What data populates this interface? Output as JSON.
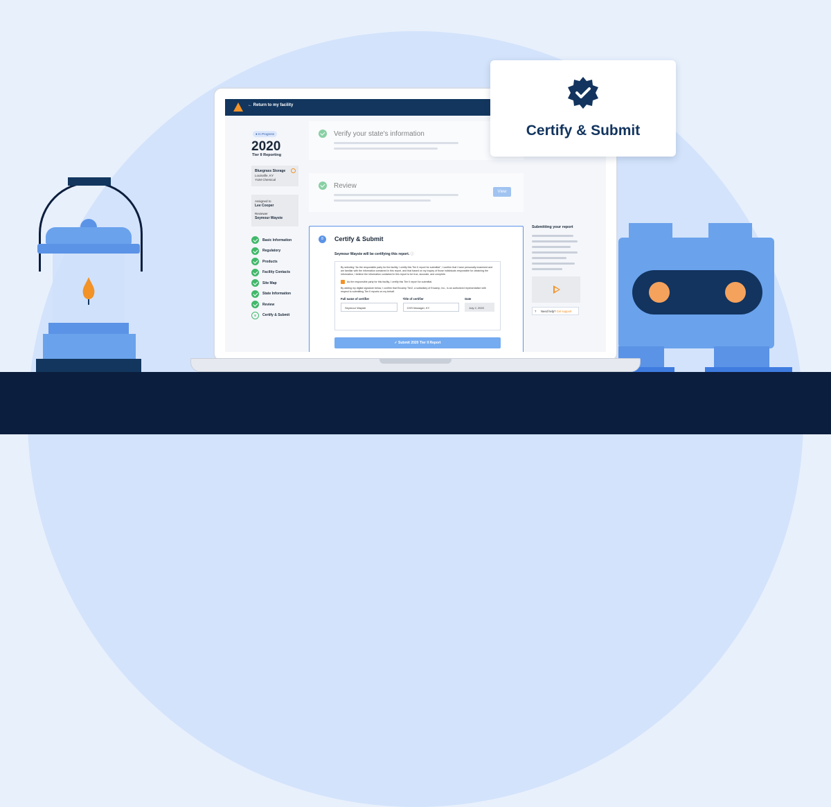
{
  "popup": {
    "title": "Certify & Submit",
    "badge_icon": "verified-check-badge"
  },
  "app": {
    "back_link": "Return to my facility",
    "status_badge": "In Progress",
    "year": "2020",
    "report_type": "Tier II Reporting",
    "facility": {
      "name": "Bluegrass Storage",
      "location": "Louisville, KY",
      "company": "YUM Chemical"
    },
    "assigned_label": "Assigned to",
    "assigned_name": "Lee Cooper",
    "reviewer_label": "Reviewer",
    "reviewer_name": "Seymour Wayste",
    "steps": [
      "Basic Information",
      "Regulatory",
      "Products",
      "Facility Contacts",
      "Site Map",
      "State Information",
      "Review",
      "Certify & Submit"
    ],
    "current_step_number": "8",
    "section1_title": "Verify your state's information",
    "section2_title": "Review",
    "view_button": "View",
    "section3_title": "Certify & Submit",
    "certifier_text": "Seymour Wayste will be certifying this report.",
    "para1": "By selecting \"As the responsible party for the facility, I certify this Tier II report for submittal\", I confirm that I have personally examined and am familiar with the information contained in this report, and that based on my inquiry of those individuals responsible for obtaining the information, I believe the information contained in this report to be true, accurate, and complete.",
    "checkbox_label": "As the responsible party for this facility, I certify this Tier II report for submittal.",
    "para2": "By adding my digital signature below, I confirm that Encamp Tier2, a subsidiary of Encamp, Inc., is an authorized representative with respect to submitting Tier II reports on my behalf.",
    "field_fullname_label": "Full name of certifier",
    "field_fullname_value": "Seymour Wayste",
    "field_title_label": "Title of certifier",
    "field_title_value": "CHS Manager, KY",
    "field_date_label": "Date",
    "field_date_value": "July 2, 2020",
    "submit_button": "Submit 2020 Tier II Report",
    "side_title": "Submitting your report",
    "help_text": "Need help?",
    "help_link": "Get support"
  },
  "colors": {
    "navy": "#12365e",
    "accent_orange": "#f29227",
    "success_green": "#41b86a",
    "primary_blue": "#5b93e6",
    "background": "#e8f0fc"
  }
}
